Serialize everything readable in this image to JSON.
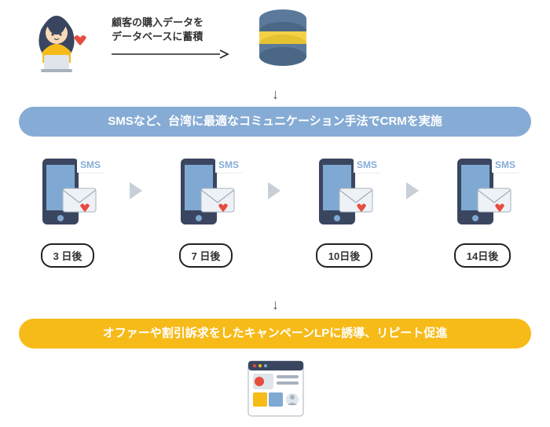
{
  "top": {
    "caption_line1": "顧客の購入データを",
    "caption_line2": "データベースに蓄積"
  },
  "bar_blue": "SMSなど、台湾に最適なコミュニケーション手法でCRMを実施",
  "bar_yellow": "オファーや割引訴求をしたキャンペーンLPに誘導、リピート促進",
  "sms": {
    "badge": "SMS",
    "items": [
      {
        "label": "3 日後"
      },
      {
        "label": "7 日後"
      },
      {
        "label": "10日後"
      },
      {
        "label": "14日後"
      }
    ]
  },
  "arrows": {
    "down": "↓"
  },
  "colors": {
    "blue": "#86acd5",
    "yellow": "#f6bb19",
    "red": "#e74c3c",
    "gray": "#a7b2bd",
    "darknavy": "#3a4660",
    "lightgray": "#dfe5ea"
  }
}
